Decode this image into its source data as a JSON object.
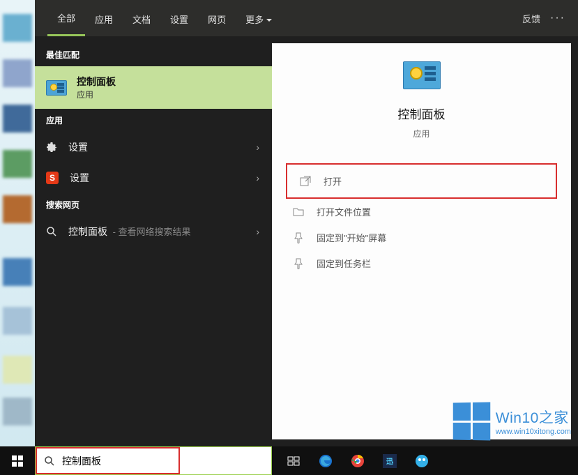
{
  "tabs": {
    "items": [
      "全部",
      "应用",
      "文档",
      "设置",
      "网页",
      "更多"
    ],
    "active": 0,
    "feedback": "反馈"
  },
  "sections": {
    "best_match": "最佳匹配",
    "apps": "应用",
    "search_web": "搜索网页"
  },
  "best_match_item": {
    "title": "控制面板",
    "subtitle": "应用"
  },
  "app_items": [
    {
      "icon": "gear-icon",
      "label": "设置"
    },
    {
      "icon": "sogou-icon",
      "label": "设置"
    }
  ],
  "web_item": {
    "label": "控制面板",
    "hint": " - 查看网络搜索结果"
  },
  "details": {
    "title": "控制面板",
    "subtitle": "应用",
    "actions": [
      {
        "icon": "open-icon",
        "label": "打开",
        "highlight": true
      },
      {
        "icon": "folder-icon",
        "label": "打开文件位置"
      },
      {
        "icon": "pin-start-icon",
        "label": "固定到\"开始\"屏幕"
      },
      {
        "icon": "pin-taskbar-icon",
        "label": "固定到任务栏"
      }
    ]
  },
  "watermark": {
    "line1": "Win10之家",
    "line2": "www.win10xitong.com"
  },
  "search": {
    "value": "控制面板"
  }
}
